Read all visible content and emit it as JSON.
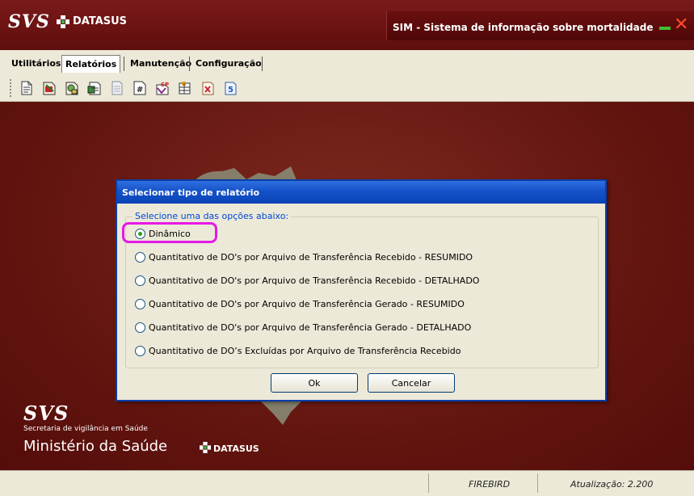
{
  "app": {
    "logo": "SVS",
    "brand": "DATASUS",
    "title": "SIM - Sistema de informação sobre mortalidade"
  },
  "menu": {
    "tabs": [
      {
        "label": "Utilitários"
      },
      {
        "label": "Relatórios",
        "active": true
      },
      {
        "label": "Manutenção"
      },
      {
        "label": "Configuração"
      }
    ]
  },
  "toolbar": {
    "icons": [
      "report-icon",
      "report-edit-icon",
      "report-search-icon",
      "report-export-icon",
      "document-icon",
      "hash-report-icon",
      "sp-report-icon",
      "table-report-icon",
      "x-report-icon",
      "s-report-icon"
    ]
  },
  "dialog": {
    "title": "Selecionar tipo de relatório",
    "group_caption": "Selecione uma das opções abaixo:",
    "options": [
      {
        "label": "Dinâmico",
        "selected": true
      },
      {
        "label": "Quantitativo de DO's por Arquivo de Transferência Recebido - RESUMIDO"
      },
      {
        "label": "Quantitativo de DO's por Arquivo de Transferência Recebido - DETALHADO"
      },
      {
        "label": "Quantitativo de DO's por Arquivo de Transferência Gerado - RESUMIDO"
      },
      {
        "label": "Quantitativo de DO's por Arquivo de Transferência Gerado - DETALHADO"
      },
      {
        "label": "Quantitativo de DO’s Excluídas por Arquivo de Transferência Recebido"
      }
    ],
    "ok_label": "Ok",
    "cancel_label": "Cancelar",
    "highlight_color": "#e619e6"
  },
  "branding": {
    "logo": "SVS",
    "secretaria": "Secretaria de vigilância em Saúde",
    "ministerio": "Ministério da Saúde",
    "brand": "DATASUS"
  },
  "status": {
    "database": "FIREBIRD",
    "update": "Atualização: 2.200"
  },
  "colors": {
    "titlebar": "#6b1212",
    "main_bg": "#63150f",
    "dialog_title": "#1552c9"
  }
}
